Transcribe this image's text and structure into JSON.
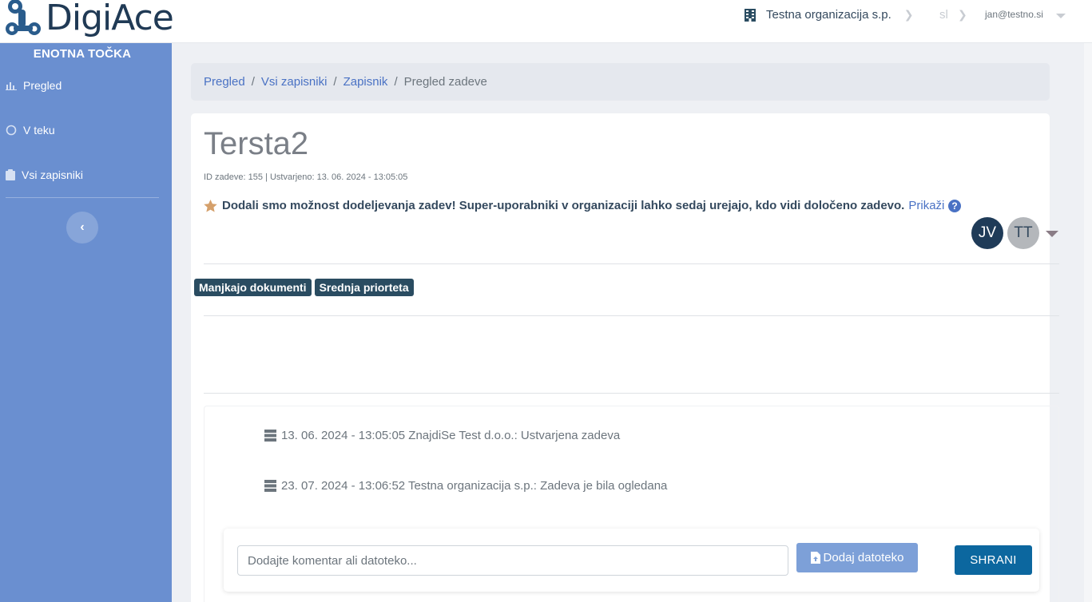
{
  "header": {
    "brand": "DigiAce",
    "organization": "Testna organizacija s.p.",
    "language": "sl",
    "user_email": "jan@testno.si"
  },
  "sidebar": {
    "title": "ENOTNA TOČKA",
    "items": [
      {
        "label": "Pregled",
        "icon": "chart-icon"
      },
      {
        "label": "V teku",
        "icon": "circle-icon"
      },
      {
        "label": "Vsi zapisniki",
        "icon": "clipboard-icon"
      }
    ],
    "collapse_icon": "chevron-left-icon"
  },
  "breadcrumb": {
    "items": [
      "Pregled",
      "Vsi zapisniki",
      "Zapisnik"
    ],
    "current": "Pregled zadeve",
    "separator": "/"
  },
  "case": {
    "title": "Tersta2",
    "meta": "ID zadeve: 155 | Ustvarjeno: 13. 06. 2024 - 13:05:05",
    "notice": "Dodali smo možnost dodeljevanja zadev! Super-uporabniki v organizaciji lahko sedaj urejajo, kdo vidi določeno zadevo.",
    "notice_link": "Prikaži",
    "assignees": [
      {
        "initials": "JV",
        "color": "#1f3b58"
      },
      {
        "initials": "TT",
        "color": "#b4b7bb"
      }
    ],
    "tags": [
      "Manjkajo dokumenti",
      "Srednja priorteta"
    ]
  },
  "activity": [
    {
      "text": "13. 06. 2024 - 13:05:05 ZnajdiSe Test d.o.o.: Ustvarjena zadeva"
    },
    {
      "text": "23. 07. 2024 - 13:06:52 Testna organizacija s.p.: Zadeva je bila ogledana"
    }
  ],
  "comment": {
    "placeholder": "Dodajte komentar ali datoteko...",
    "file_button": "Dodaj datoteko",
    "save_button": "SHRANI"
  },
  "colors": {
    "sidebar": "#6a8fd0",
    "primary_dark": "#1f3b58",
    "link": "#4a72c4",
    "save": "#0c679f",
    "tag": "#2a4c61"
  }
}
